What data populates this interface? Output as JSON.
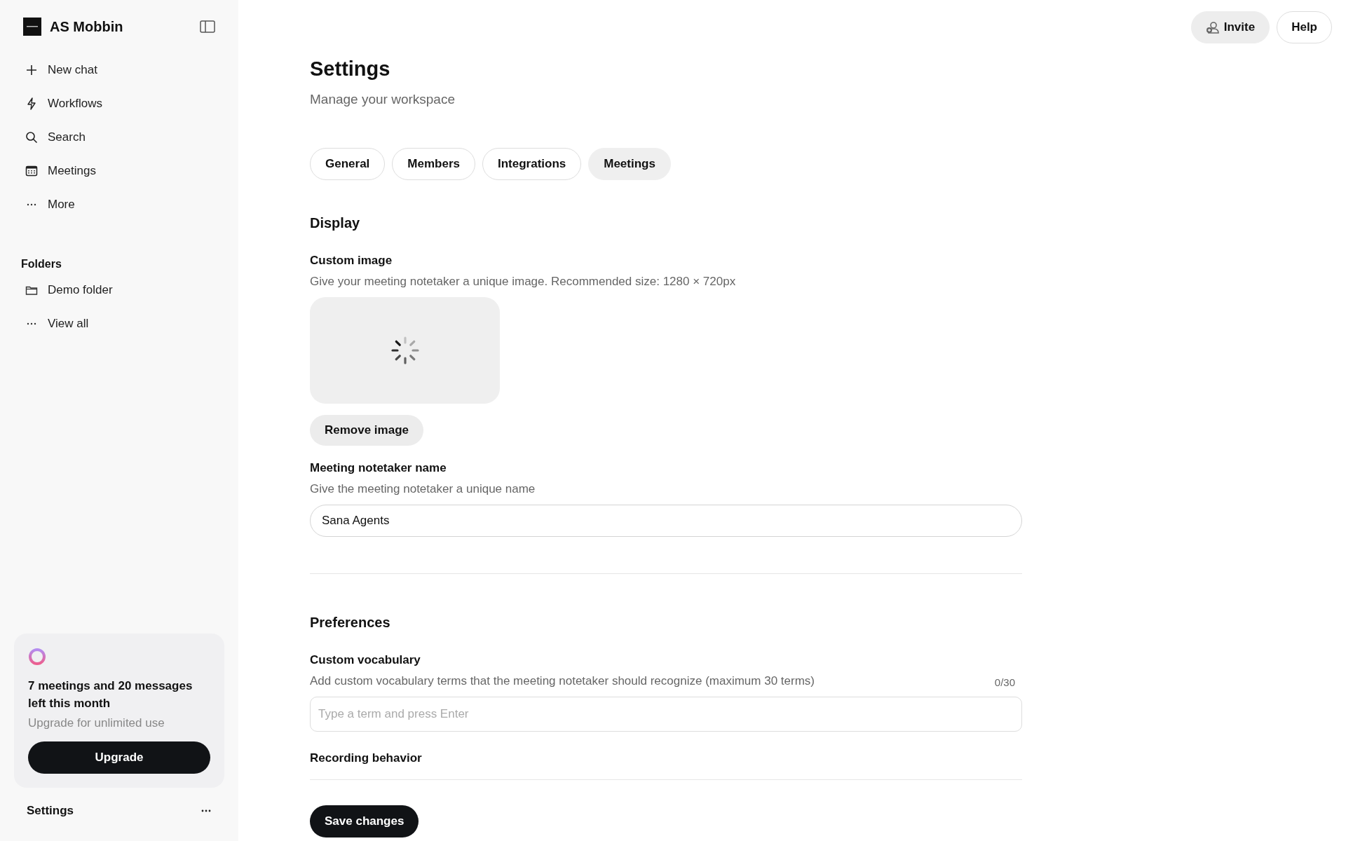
{
  "sidebar": {
    "workspace": "AS Mobbin",
    "nav": [
      {
        "label": "New chat",
        "kind": "plus"
      },
      {
        "label": "Workflows",
        "kind": "bolt"
      },
      {
        "label": "Search",
        "kind": "search"
      },
      {
        "label": "Meetings",
        "kind": "calendar"
      },
      {
        "label": "More",
        "kind": "dots"
      }
    ],
    "folders_heading": "Folders",
    "folders": [
      {
        "label": "Demo folder",
        "kind": "folder"
      },
      {
        "label": "View all",
        "kind": "dots"
      }
    ],
    "usage_card": {
      "title": "7 meetings and 20 messages left this month",
      "subtitle": "Upgrade for unlimited use",
      "button": "Upgrade"
    },
    "footer": {
      "label": "Settings"
    }
  },
  "header_buttons": [
    {
      "label": "Invite",
      "kind": "filled"
    },
    {
      "label": "Help",
      "kind": "outline"
    }
  ],
  "page": {
    "title": "Settings",
    "subtitle": "Manage your workspace"
  },
  "tabs": [
    {
      "label": "General",
      "selected": false
    },
    {
      "label": "Members",
      "selected": false
    },
    {
      "label": "Integrations",
      "selected": false
    },
    {
      "label": "Meetings",
      "selected": true
    }
  ],
  "display": {
    "heading": "Display",
    "custom_image": {
      "label": "Custom image",
      "description": "Give your meeting notetaker a unique image. Recommended size: 1280 × 720px",
      "loading": true,
      "remove_button": "Remove image"
    },
    "notetaker_name": {
      "label": "Meeting notetaker name",
      "description": "Give the meeting notetaker a unique name",
      "value": "Sana Agents"
    }
  },
  "preferences": {
    "heading": "Preferences",
    "custom_vocabulary": {
      "label": "Custom vocabulary",
      "description": "Add custom vocabulary terms that the meeting notetaker should recognize (maximum 30 terms)",
      "counter": "0/30",
      "placeholder": "Type a term and press Enter"
    },
    "recording_behavior": {
      "label": "Recording behavior"
    }
  },
  "save_button": "Save changes"
}
